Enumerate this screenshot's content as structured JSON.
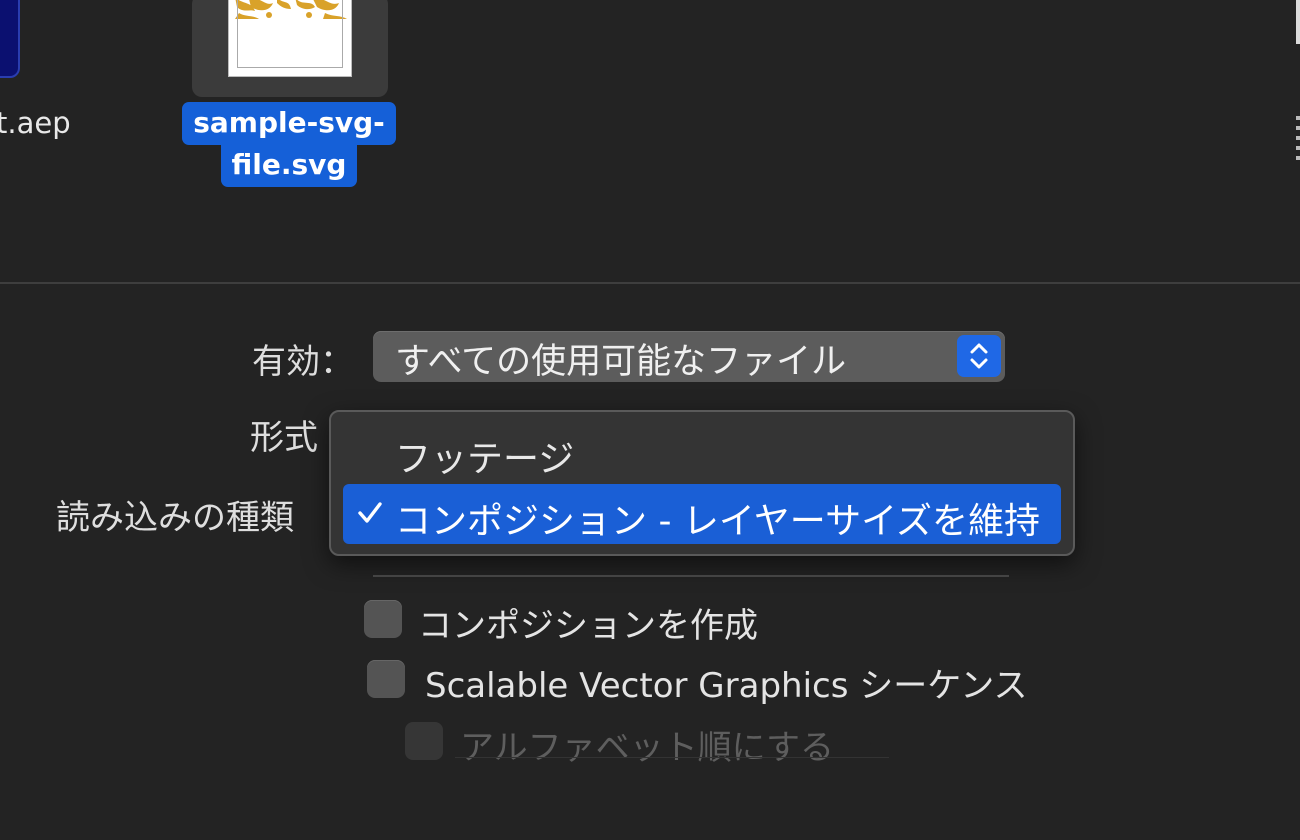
{
  "files": [
    {
      "name": "t.aep",
      "selected": false
    },
    {
      "name_line1": "sample-svg-",
      "name_line2": "file.svg",
      "selected": true
    }
  ],
  "form": {
    "enable": {
      "label": "有効：",
      "value": "すべての使用可能なファイル"
    },
    "format": {
      "label": "形式"
    },
    "import_as": {
      "label": "読み込みの種類"
    }
  },
  "menu": {
    "items": [
      {
        "label": "フッテージ",
        "checked": false
      },
      {
        "label": "コンポジション - レイヤーサイズを維持",
        "checked": true
      }
    ]
  },
  "options": [
    {
      "label": "コンポジションを作成",
      "checked": false,
      "enabled": true
    },
    {
      "label": "Scalable Vector Graphics シーケンス",
      "checked": false,
      "enabled": true
    },
    {
      "label": "アルファベット順にする",
      "checked": false,
      "enabled": false
    }
  ],
  "colors": {
    "background": "#232323",
    "accent": "#1560d8",
    "menu_bg": "#343434"
  }
}
